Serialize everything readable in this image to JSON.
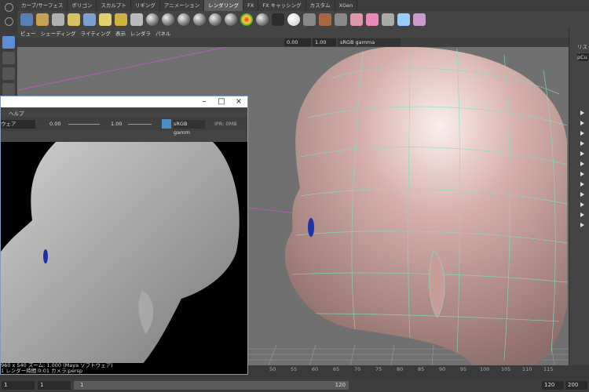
{
  "shelf": {
    "tabs": [
      "カーブ/サーフェス",
      "ポリゴン",
      "スカルプト",
      "リギング",
      "アニメーション",
      "レンダリング",
      "FX",
      "FX キャッシング",
      "カスタム",
      "XGen"
    ],
    "active_tab": "レンダリング"
  },
  "viewport": {
    "panel_menu": [
      "ビュー",
      "シェーディング",
      "ライティング",
      "表示",
      "レンダラ",
      "パネル"
    ],
    "exposure": "0.00",
    "gamma": "1.00",
    "color_space": "sRGB gamma"
  },
  "right_panel": {
    "label": "リスト",
    "field": "pCu"
  },
  "render_view": {
    "menu_item": "ヘルプ",
    "dropdown": "ウェア",
    "exposure": "0.00",
    "gamma": "1.00",
    "color_space": "sRGB gamm",
    "ipr": "IPR: 0MB",
    "info_line1": "960 x 540 ズーム: 1.000  (Maya ソフトウェア)",
    "info_line2": "1   レンダー時間:0:01   カメラ:persp"
  },
  "timeline": {
    "ticks": [
      "50",
      "55",
      "60",
      "65",
      "70",
      "75",
      "80",
      "85",
      "90",
      "95",
      "100",
      "105",
      "110",
      "115"
    ]
  },
  "range": {
    "start": "1",
    "current": "1",
    "slider_start": "1",
    "slider_end": "120",
    "end": "120",
    "max": "200"
  },
  "colors": {
    "skin": "#d9b3ad",
    "wire": "#7fe0c0",
    "accent": "#5d5d5d"
  }
}
